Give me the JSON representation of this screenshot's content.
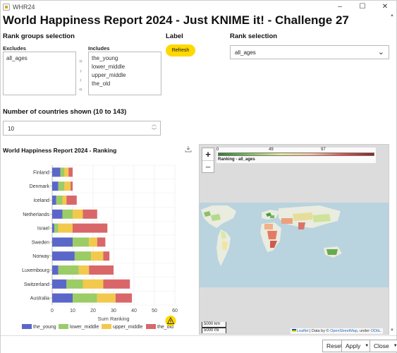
{
  "window": {
    "title": "WHR24",
    "minimize": "–",
    "maximize": "☐",
    "close": "✕"
  },
  "page_title": "World Happiness Report 2024 - Just KNIME it! - Challenge 27",
  "rank_groups": {
    "label": "Rank groups selection",
    "excludes_label": "Excludes",
    "includes_label": "Includes",
    "excludes": [
      "all_ages"
    ],
    "includes": [
      "the_young",
      "lower_middle",
      "upper_middle",
      "the_old"
    ],
    "shuttle": [
      "»",
      "›",
      "‹",
      "«"
    ]
  },
  "label_section": {
    "label": "Label",
    "refresh": "Refresh"
  },
  "rank_selection": {
    "label": "Rank selection",
    "value": "all_ages"
  },
  "countries_shown": {
    "label": "Number of countries shown (10 to 143)",
    "value": "10"
  },
  "icons": {
    "download": "download-icon",
    "warning": "warning-icon",
    "chevron": "chevron-down-icon"
  },
  "chart_title": "World Happiness Report 2024 - Ranking",
  "chart_data": {
    "type": "bar",
    "orientation": "horizontal",
    "stacked": true,
    "categories": [
      "Finland",
      "Denmark",
      "Iceland",
      "Netherlands",
      "Israel",
      "Sweden",
      "Norway",
      "Luxembourg",
      "Switzerland",
      "Australia"
    ],
    "series": [
      {
        "name": "the_young",
        "color": "#5b67c8",
        "values": [
          4,
          3,
          2,
          5,
          1,
          10,
          11,
          3,
          7,
          10
        ]
      },
      {
        "name": "lower_middle",
        "color": "#9ccc65",
        "values": [
          2,
          3,
          3,
          5,
          2,
          8,
          8,
          10,
          8,
          12
        ]
      },
      {
        "name": "upper_middle",
        "color": "#f2c94c",
        "values": [
          2,
          3,
          2,
          5,
          7,
          4,
          6,
          5,
          10,
          9
        ]
      },
      {
        "name": "the_old",
        "color": "#d9676a",
        "values": [
          2,
          1,
          5,
          7,
          17,
          4,
          3,
          12,
          13,
          8
        ]
      }
    ],
    "xlabel": "Sum Ranking",
    "xlim": [
      0,
      60
    ],
    "xticks": [
      "0",
      "10",
      "20",
      "30",
      "40",
      "50",
      "60"
    ],
    "grid": true,
    "legend": "bottom"
  },
  "map": {
    "zoom_in": "+",
    "zoom_out": "−",
    "legend_ticks": [
      "0",
      "49",
      "97"
    ],
    "legend_caption": "Ranking - all_ages",
    "scale_km": "5000 km",
    "scale_mi": "5000 mi",
    "attribution_leaflet": "Leaflet",
    "attribution_mid": " | Data by © ",
    "attribution_osm": "OpenStreetMap",
    "attribution_end": ", under ",
    "attribution_odbl": "ODbL."
  },
  "footer": {
    "reset": "Reset",
    "apply": "Apply",
    "close": "Close",
    "dropdown": "▼"
  }
}
